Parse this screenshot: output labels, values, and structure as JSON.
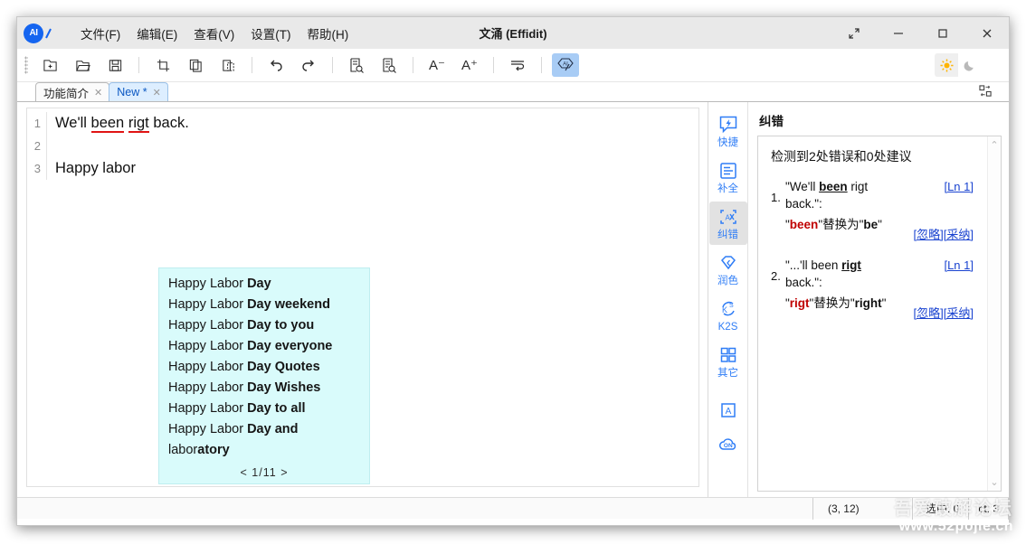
{
  "window": {
    "title": "文涌 (Effidit)",
    "logo_text": "AI",
    "controls": {
      "expand": "⤢",
      "minimize": "—",
      "maximize": "□",
      "close": "✕"
    }
  },
  "menubar": [
    {
      "label": "文件(F)",
      "name": "menu-file"
    },
    {
      "label": "编辑(E)",
      "name": "menu-edit"
    },
    {
      "label": "查看(V)",
      "name": "menu-view"
    },
    {
      "label": "设置(T)",
      "name": "menu-settings"
    },
    {
      "label": "帮助(H)",
      "name": "menu-help"
    }
  ],
  "toolbar": {
    "items": [
      {
        "name": "new-file-icon",
        "glyph": "⊞"
      },
      {
        "name": "open-folder-icon",
        "glyph": "🗁"
      },
      {
        "name": "save-icon",
        "glyph": "🖫"
      },
      {
        "name": "cut-icon",
        "glyph": "⛶"
      },
      {
        "name": "copy-icon",
        "glyph": "⧉"
      },
      {
        "name": "paste-icon",
        "glyph": "⎘"
      },
      {
        "name": "undo-icon",
        "glyph": "↶"
      },
      {
        "name": "redo-icon",
        "glyph": "↷"
      },
      {
        "name": "find-icon",
        "glyph": "🔎"
      },
      {
        "name": "replace-icon",
        "glyph": "🔍"
      },
      {
        "name": "font-decrease-icon",
        "glyph": "A⁻"
      },
      {
        "name": "font-increase-icon",
        "glyph": "A⁺"
      },
      {
        "name": "wrap-text-icon",
        "glyph": "⇥"
      },
      {
        "name": "ai-assist-icon",
        "glyph": "AI"
      }
    ],
    "theme_light": "☀",
    "theme_dark": "☾",
    "layout_icon": "⧉"
  },
  "tabs": [
    {
      "label": "功能简介",
      "close": "✕",
      "active": false
    },
    {
      "label": "New *",
      "close": "✕",
      "active": true
    }
  ],
  "editor": {
    "lines": [
      {
        "number": "1",
        "segments": [
          {
            "text": "We'll ",
            "error": false
          },
          {
            "text": "been",
            "error": true
          },
          {
            "text": " ",
            "error": false
          },
          {
            "text": "rigt",
            "error": true
          },
          {
            "text": " back.",
            "error": false
          }
        ]
      },
      {
        "number": "2",
        "segments": [
          {
            "text": "",
            "error": false
          }
        ]
      },
      {
        "number": "3",
        "segments": [
          {
            "text": "Happy labor",
            "error": false
          }
        ]
      }
    ]
  },
  "autocomplete": {
    "suggestions": [
      {
        "prefix": "Happy Labor ",
        "completion": "Day"
      },
      {
        "prefix": "Happy Labor ",
        "completion": "Day weekend"
      },
      {
        "prefix": "Happy Labor ",
        "completion": "Day to you"
      },
      {
        "prefix": "Happy Labor ",
        "completion": "Day everyone"
      },
      {
        "prefix": "Happy Labor ",
        "completion": "Day Quotes"
      },
      {
        "prefix": "Happy Labor ",
        "completion": "Day Wishes"
      },
      {
        "prefix": "Happy Labor ",
        "completion": "Day to all"
      },
      {
        "prefix": "Happy Labor ",
        "completion": "Day and"
      },
      {
        "prefix": "labor",
        "completion": "atory"
      }
    ],
    "pager_prev": "<",
    "pager_text": "1/11",
    "pager_next": ">"
  },
  "rail": [
    {
      "label": "快捷",
      "icon": "⚡",
      "name": "rail-item-quick",
      "selected": false
    },
    {
      "label": "补全",
      "icon": "▤",
      "name": "rail-item-complete",
      "selected": false
    },
    {
      "label": "纠错",
      "icon": "A⃞",
      "name": "rail-item-correct",
      "selected": true
    },
    {
      "label": "润色",
      "icon": "◈",
      "name": "rail-item-polish",
      "selected": false
    },
    {
      "label": "K2S",
      "icon": "K",
      "name": "rail-item-k2s",
      "selected": false
    },
    {
      "label": "其它",
      "icon": "▦",
      "name": "rail-item-other",
      "selected": false
    },
    {
      "label": "",
      "icon": "A",
      "name": "rail-item-font",
      "selected": false
    },
    {
      "label": "",
      "icon": "ON",
      "name": "rail-item-online-status",
      "selected": false
    }
  ],
  "panel": {
    "title": "纠错",
    "summary": "检测到2处错误和0处建议",
    "issues": [
      {
        "number": "1.",
        "quote_pre": "\"We'll ",
        "quote_em": "been",
        "quote_post": " rigt back.\":",
        "fix_bad": "been",
        "fix_mid": "\"替换为\"",
        "fix_good": "be",
        "fix_prefix": "\"",
        "fix_suffix": "\"",
        "line_link": "[Ln 1]",
        "ignore": "[忽略]",
        "accept": "[采纳]"
      },
      {
        "number": "2.",
        "quote_pre": "\"...'ll been ",
        "quote_em": "rigt",
        "quote_post": " back.\":",
        "fix_bad": "rigt",
        "fix_mid": "\"替换为\"",
        "fix_good": "right",
        "fix_prefix": "\"",
        "fix_suffix": "\"",
        "line_link": "[Ln 1]",
        "ignore": "[忽略]",
        "accept": "[采纳]"
      }
    ],
    "scroll_up": "⌃",
    "scroll_down": "⌄"
  },
  "statusbar": {
    "position": "(3, 12)",
    "selection": "选中: 0",
    "count": "ct: 3"
  },
  "watermark": {
    "line1": "吾爱破解论坛",
    "line2": "www.52pojie.cn"
  },
  "colors": {
    "accent": "#2f7df6",
    "error": "#e01414",
    "link": "#1a43d0",
    "popup_bg": "#d9fbfb",
    "tab_active_bg": "#ddeeff"
  }
}
